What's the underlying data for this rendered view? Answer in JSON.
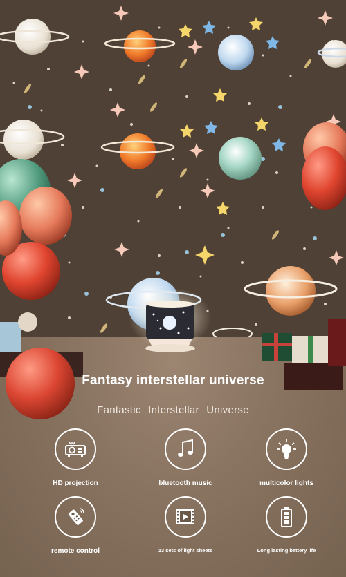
{
  "headline": "Fantasy interstellar universe",
  "subheadline": "Fantastic  Interstellar  Universe",
  "features": [
    {
      "label": "HD projection",
      "icon": "projector-icon"
    },
    {
      "label": "bluetooth music",
      "icon": "music-note-icon"
    },
    {
      "label": "multicolor lights",
      "icon": "light-bulb-icon"
    },
    {
      "label": "remote control",
      "icon": "remote-control-icon"
    },
    {
      "label": "13 sets of light sheets",
      "icon": "film-play-icon"
    },
    {
      "label": "Long lasting battery life",
      "icon": "battery-icon"
    }
  ],
  "colors": {
    "accent_white": "#ffffff",
    "wall": "#5a4a3e",
    "floor": "#8a7664"
  }
}
